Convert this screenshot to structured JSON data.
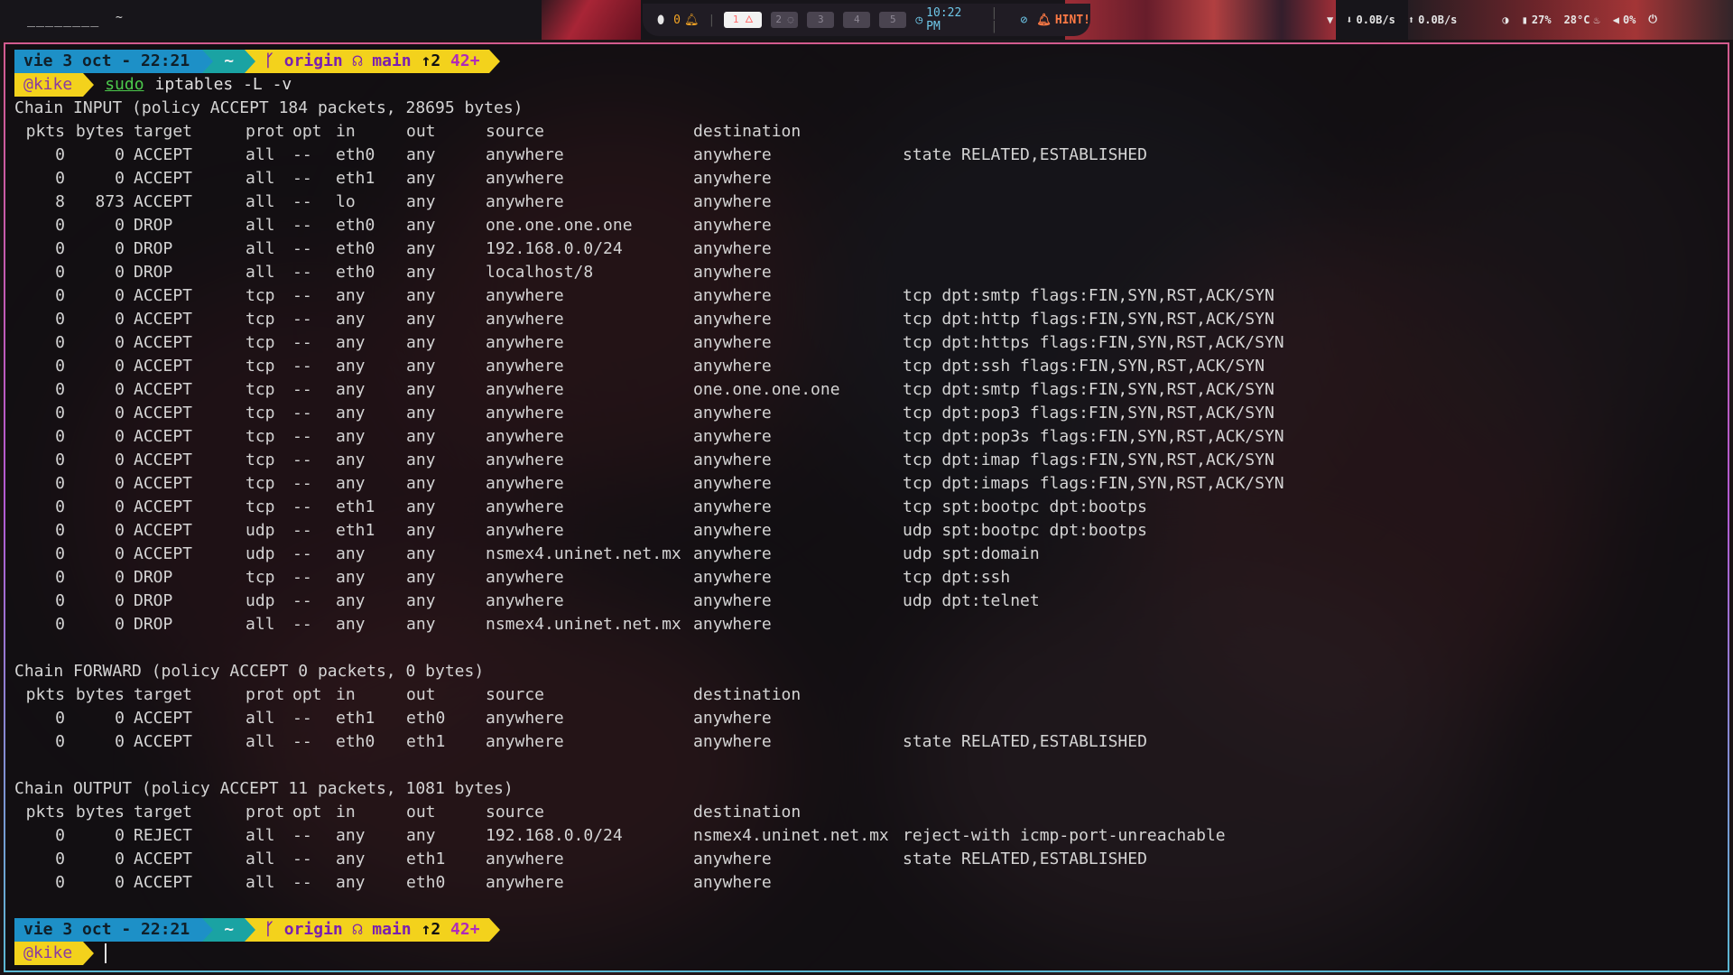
{
  "topbar": {
    "left_label": "________",
    "left_tilde": "~",
    "notification_count": "0",
    "workspaces": [
      "1",
      "2",
      "3",
      "4",
      "5"
    ],
    "time": "10:22 PM",
    "hint": "HINT!",
    "net_down": "0.0B/s",
    "net_up": "0.0B/s",
    "battery": "27%",
    "temperature": "28°C",
    "volume": "0%"
  },
  "prompt": {
    "date": "vie  3 oct - 22:21",
    "path": "~",
    "remote": "origin",
    "branch": "main",
    "ahead": "↑2",
    "modified": "42+",
    "user": "@kike"
  },
  "command": {
    "sudo": "sudo",
    "rest": "iptables -L -v"
  },
  "columns": [
    "pkts",
    "bytes",
    "target",
    "prot",
    "opt",
    "in",
    "out",
    "source",
    "destination"
  ],
  "chains": [
    {
      "header": "Chain INPUT (policy ACCEPT 184 packets, 28695 bytes)",
      "rules": [
        [
          "0",
          "0",
          "ACCEPT",
          "all",
          "--",
          "eth0",
          "any",
          "anywhere",
          "anywhere",
          "state RELATED,ESTABLISHED"
        ],
        [
          "0",
          "0",
          "ACCEPT",
          "all",
          "--",
          "eth1",
          "any",
          "anywhere",
          "anywhere",
          ""
        ],
        [
          "8",
          "873",
          "ACCEPT",
          "all",
          "--",
          "lo",
          "any",
          "anywhere",
          "anywhere",
          ""
        ],
        [
          "0",
          "0",
          "DROP",
          "all",
          "--",
          "eth0",
          "any",
          "one.one.one.one",
          "anywhere",
          ""
        ],
        [
          "0",
          "0",
          "DROP",
          "all",
          "--",
          "eth0",
          "any",
          "192.168.0.0/24",
          "anywhere",
          ""
        ],
        [
          "0",
          "0",
          "DROP",
          "all",
          "--",
          "eth0",
          "any",
          "localhost/8",
          "anywhere",
          ""
        ],
        [
          "0",
          "0",
          "ACCEPT",
          "tcp",
          "--",
          "any",
          "any",
          "anywhere",
          "anywhere",
          "tcp dpt:smtp flags:FIN,SYN,RST,ACK/SYN"
        ],
        [
          "0",
          "0",
          "ACCEPT",
          "tcp",
          "--",
          "any",
          "any",
          "anywhere",
          "anywhere",
          "tcp dpt:http flags:FIN,SYN,RST,ACK/SYN"
        ],
        [
          "0",
          "0",
          "ACCEPT",
          "tcp",
          "--",
          "any",
          "any",
          "anywhere",
          "anywhere",
          "tcp dpt:https flags:FIN,SYN,RST,ACK/SYN"
        ],
        [
          "0",
          "0",
          "ACCEPT",
          "tcp",
          "--",
          "any",
          "any",
          "anywhere",
          "anywhere",
          "tcp dpt:ssh flags:FIN,SYN,RST,ACK/SYN"
        ],
        [
          "0",
          "0",
          "ACCEPT",
          "tcp",
          "--",
          "any",
          "any",
          "anywhere",
          "one.one.one.one",
          "tcp dpt:smtp flags:FIN,SYN,RST,ACK/SYN"
        ],
        [
          "0",
          "0",
          "ACCEPT",
          "tcp",
          "--",
          "any",
          "any",
          "anywhere",
          "anywhere",
          "tcp dpt:pop3 flags:FIN,SYN,RST,ACK/SYN"
        ],
        [
          "0",
          "0",
          "ACCEPT",
          "tcp",
          "--",
          "any",
          "any",
          "anywhere",
          "anywhere",
          "tcp dpt:pop3s flags:FIN,SYN,RST,ACK/SYN"
        ],
        [
          "0",
          "0",
          "ACCEPT",
          "tcp",
          "--",
          "any",
          "any",
          "anywhere",
          "anywhere",
          "tcp dpt:imap flags:FIN,SYN,RST,ACK/SYN"
        ],
        [
          "0",
          "0",
          "ACCEPT",
          "tcp",
          "--",
          "any",
          "any",
          "anywhere",
          "anywhere",
          "tcp dpt:imaps flags:FIN,SYN,RST,ACK/SYN"
        ],
        [
          "0",
          "0",
          "ACCEPT",
          "tcp",
          "--",
          "eth1",
          "any",
          "anywhere",
          "anywhere",
          "tcp spt:bootpc dpt:bootps"
        ],
        [
          "0",
          "0",
          "ACCEPT",
          "udp",
          "--",
          "eth1",
          "any",
          "anywhere",
          "anywhere",
          "udp spt:bootpc dpt:bootps"
        ],
        [
          "0",
          "0",
          "ACCEPT",
          "udp",
          "--",
          "any",
          "any",
          "nsmex4.uninet.net.mx",
          "anywhere",
          "udp spt:domain"
        ],
        [
          "0",
          "0",
          "DROP",
          "tcp",
          "--",
          "any",
          "any",
          "anywhere",
          "anywhere",
          "tcp dpt:ssh"
        ],
        [
          "0",
          "0",
          "DROP",
          "udp",
          "--",
          "any",
          "any",
          "anywhere",
          "anywhere",
          "udp dpt:telnet"
        ],
        [
          "0",
          "0",
          "DROP",
          "all",
          "--",
          "any",
          "any",
          "nsmex4.uninet.net.mx",
          "anywhere",
          ""
        ]
      ]
    },
    {
      "header": "Chain FORWARD (policy ACCEPT 0 packets, 0 bytes)",
      "rules": [
        [
          "0",
          "0",
          "ACCEPT",
          "all",
          "--",
          "eth1",
          "eth0",
          "anywhere",
          "anywhere",
          ""
        ],
        [
          "0",
          "0",
          "ACCEPT",
          "all",
          "--",
          "eth0",
          "eth1",
          "anywhere",
          "anywhere",
          "state RELATED,ESTABLISHED"
        ]
      ]
    },
    {
      "header": "Chain OUTPUT (policy ACCEPT 11 packets, 1081 bytes)",
      "rules": [
        [
          "0",
          "0",
          "REJECT",
          "all",
          "--",
          "any",
          "any",
          "192.168.0.0/24",
          "nsmex4.uninet.net.mx",
          "reject-with icmp-port-unreachable"
        ],
        [
          "0",
          "0",
          "ACCEPT",
          "all",
          "--",
          "any",
          "eth1",
          "anywhere",
          "anywhere",
          "state RELATED,ESTABLISHED"
        ],
        [
          "0",
          "0",
          "ACCEPT",
          "all",
          "--",
          "any",
          "eth0",
          "anywhere",
          "anywhere",
          ""
        ]
      ]
    }
  ]
}
